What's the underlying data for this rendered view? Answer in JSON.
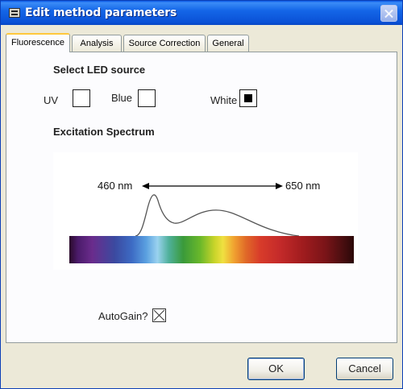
{
  "window": {
    "title": "Edit method parameters",
    "title_icon": "app-icon",
    "close_icon": "close-icon"
  },
  "tabs": [
    {
      "label": "Fluorescence",
      "active": true
    },
    {
      "label": "Analysis",
      "active": false
    },
    {
      "label": "Source Correction",
      "active": false
    },
    {
      "label": "General",
      "active": false
    }
  ],
  "fluorescence": {
    "led_heading": "Select LED source",
    "led_options": [
      {
        "label": "UV",
        "checked": false
      },
      {
        "label": "Blue",
        "checked": false
      },
      {
        "label": "White",
        "checked": true
      }
    ],
    "spectrum_heading": "Excitation Spectrum",
    "spectrum": {
      "start_label": "460 nm",
      "end_label": "650 nm"
    },
    "autogain_label": "AutoGain?",
    "autogain_checked": true
  },
  "buttons": {
    "ok": "OK",
    "cancel": "Cancel"
  },
  "colors": {
    "titlebar": "#0a58e6",
    "face": "#ece9d8",
    "panel": "#fcfcfe",
    "tab_highlight": "#ffc83c"
  }
}
